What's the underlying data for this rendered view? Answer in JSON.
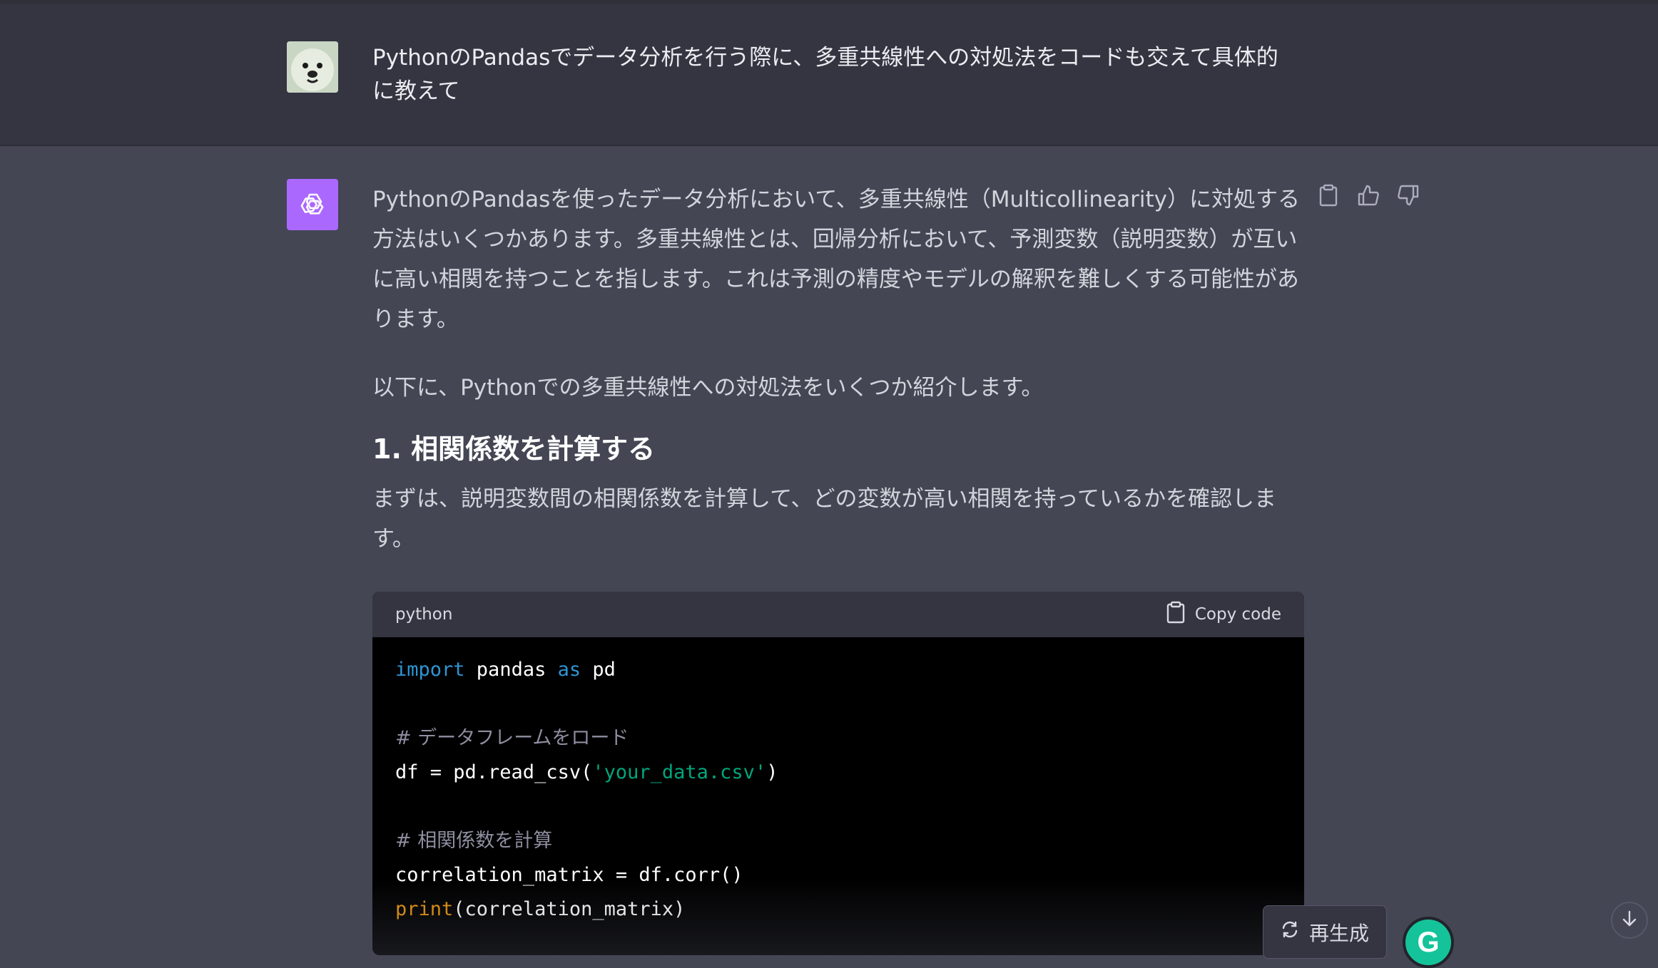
{
  "user_message": {
    "text": "PythonのPandasでデータ分析を行う際に、多重共線性への対処法をコードも交えて具体的に教えて"
  },
  "assistant_message": {
    "intro": "PythonのPandasを使ったデータ分析において、多重共線性（Multicollinearity）に対処する方法はいくつかあります。多重共線性とは、回帰分析において、予測変数（説明変数）が互いに高い相関を持つことを指します。これは予測の精度やモデルの解釈を難しくする可能性があります。",
    "lead": "以下に、Pythonでの多重共線性への対処法をいくつか紹介します。",
    "section_heading": "1. 相関係数を計算する",
    "section_desc": "まずは、説明変数間の相関係数を計算して、どの変数が高い相関を持っているかを確認します。"
  },
  "code_block": {
    "language": "python",
    "copy_label": "Copy code",
    "line1": {
      "kw1": "import",
      "mid": " pandas ",
      "kw2": "as",
      "end": " pd"
    },
    "comment1": "# データフレームをロード",
    "line3": {
      "pre": "df = pd.read_csv(",
      "str": "'your_data.csv'",
      "post": ")"
    },
    "comment2": "# 相関係数を計算",
    "line5": "correlation_matrix = df.corr()",
    "line6": {
      "fn": "print",
      "rest": "(correlation_matrix)"
    }
  },
  "actions": {
    "icons": [
      "clipboard-icon",
      "thumbs-up-icon",
      "thumbs-down-icon"
    ]
  },
  "regenerate": {
    "label": "再生成"
  },
  "grammarly": {
    "letter": "G"
  }
}
